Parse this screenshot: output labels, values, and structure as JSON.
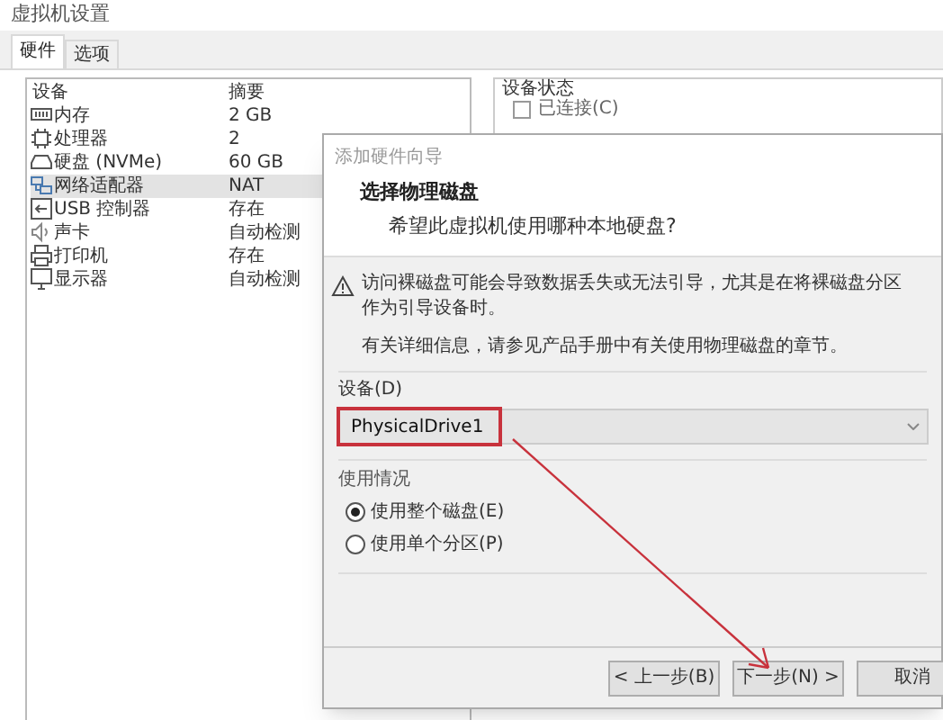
{
  "window": {
    "title": "虚拟机设置"
  },
  "tabs": [
    {
      "label": "硬件",
      "selected": true
    },
    {
      "label": "选项",
      "selected": false
    }
  ],
  "device_list": {
    "columns": [
      "设备",
      "摘要"
    ],
    "rows": [
      {
        "device": "内存",
        "summary": "2 GB",
        "selected": false
      },
      {
        "device": "处理器",
        "summary": "2",
        "selected": false
      },
      {
        "device": "硬盘 (NVMe)",
        "summary": "60 GB",
        "selected": false
      },
      {
        "device": "网络适配器",
        "summary": "NAT",
        "selected": true
      },
      {
        "device": "USB 控制器",
        "summary": "存在",
        "selected": false
      },
      {
        "device": "声卡",
        "summary": "自动检测",
        "selected": false
      },
      {
        "device": "打印机",
        "summary": "存在",
        "selected": false
      },
      {
        "device": "显示器",
        "summary": "自动检测",
        "selected": false
      }
    ]
  },
  "device_status": {
    "title": "设备状态",
    "connected": {
      "label": "已连接(C)",
      "checked": false
    }
  },
  "dialog": {
    "title": "添加硬件向导",
    "heading": "选择物理磁盘",
    "subtitle": "希望此虚拟机使用哪种本地硬盘?",
    "warning": "访问裸磁盘可能会导致数据丢失或无法引导，尤其是在将裸磁盘分区作为引导设备时。",
    "info": "有关详细信息，请参见产品手册中有关使用物理磁盘的章节。",
    "device_label": "设备(D)",
    "device_value": "PhysicalDrive1",
    "usage_title": "使用情况",
    "usage_options": [
      {
        "label": "使用整个磁盘(E)",
        "selected": true
      },
      {
        "label": "使用单个分区(P)",
        "selected": false
      }
    ],
    "buttons": [
      "< 上一步(B)",
      "下一步(N) >",
      "取消"
    ]
  }
}
